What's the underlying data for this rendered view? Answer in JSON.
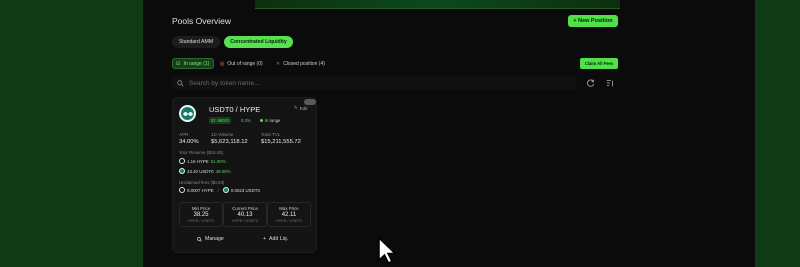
{
  "header": {
    "title": "Pools Overview",
    "new_position": "+ New Position"
  },
  "tabs": [
    "Standard AMM",
    "Concentrated Liquidity"
  ],
  "filters": {
    "in_range": "In range (1)",
    "out_of_range": "Out of range (0)",
    "closed": "Closed position (4)"
  },
  "claim_all": "Claim All Fees",
  "search": {
    "placeholder": "Search by token name..."
  },
  "card": {
    "pair": "USDT0 / HYPE",
    "edit": "Edit",
    "fee_tier": "ID: 96002",
    "pct": "0.3%",
    "status": "In range",
    "apr_label": "APR",
    "apr": "34.00%",
    "vol_label": "1D Volume",
    "vol": "$5,623,118.12",
    "tvl_label": "Total TVL",
    "tvl": "$15,211,555.72",
    "reserve_label": "Your Reserve ($19.45)",
    "reserve_hype": "1.16 HYPE",
    "reserve_hype_pct": "51.00%",
    "reserve_usd": "33.40 USDT0",
    "reserve_usd_pct": "49.00%",
    "fees_label": "Unclaimed fees ($0.03)",
    "fee_hype": "0.0007 HYPE",
    "fee_sep": "/",
    "fee_usd": "0.0023 USDT0",
    "min_label": "Min Price",
    "min_val": "38.25",
    "cur_label": "Current Price",
    "cur_val": "40.13",
    "max_label": "Max Price",
    "max_val": "42.11",
    "unit": "HYPE / USDT0",
    "manage": "Manage",
    "add_liq": "Add Liq."
  },
  "colors": {
    "accent": "#4fe04a",
    "card_bg": "#141414",
    "page_bg": "#0b0b0b"
  }
}
